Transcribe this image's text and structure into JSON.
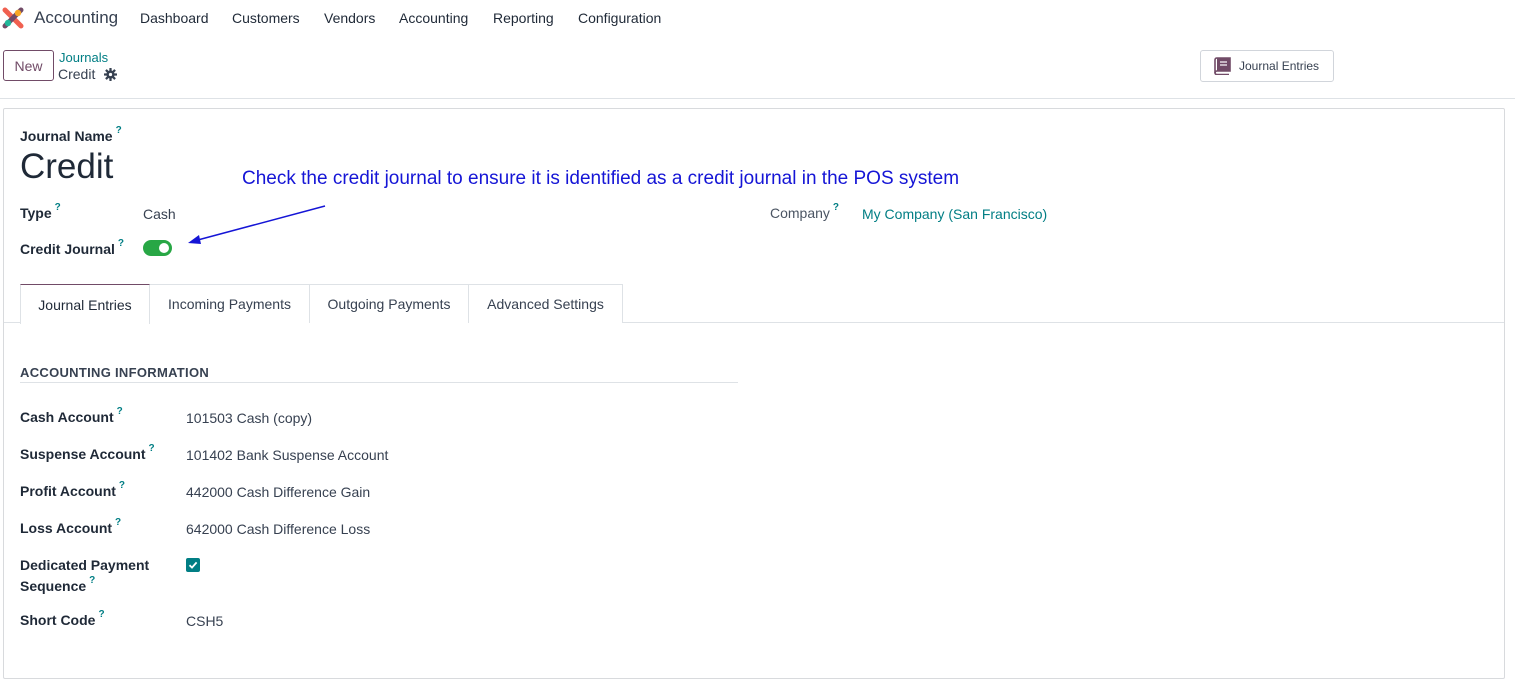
{
  "nav": {
    "app_name": "Accounting",
    "menus": [
      "Dashboard",
      "Customers",
      "Vendors",
      "Accounting",
      "Reporting",
      "Configuration"
    ]
  },
  "control_panel": {
    "new_label": "New",
    "breadcrumb_parent": "Journals",
    "breadcrumb_current": "Credit",
    "journal_entries_button": "Journal Entries"
  },
  "form": {
    "journal_name_label": "Journal Name",
    "journal_name": "Credit",
    "type_label": "Type",
    "type_value": "Cash",
    "credit_journal_label": "Credit Journal",
    "credit_journal_enabled": true,
    "company_label": "Company",
    "company_value": "My Company (San Francisco)",
    "help_mark": "?"
  },
  "annotation": "Check the credit journal to ensure it is identified as a credit journal in the POS system",
  "tabs": [
    "Journal Entries",
    "Incoming Payments",
    "Outgoing Payments",
    "Advanced Settings"
  ],
  "accounting_info": {
    "section_title": "ACCOUNTING INFORMATION",
    "cash_account_label": "Cash Account",
    "cash_account": "101503 Cash (copy)",
    "suspense_account_label": "Suspense Account",
    "suspense_account": "101402 Bank Suspense Account",
    "profit_account_label": "Profit Account",
    "profit_account": "442000 Cash Difference Gain",
    "loss_account_label": "Loss Account",
    "loss_account": "642000 Cash Difference Loss",
    "dedicated_seq_label_1": "Dedicated Payment",
    "dedicated_seq_label_2": "Sequence",
    "dedicated_seq_checked": true,
    "short_code_label": "Short Code",
    "short_code": "CSH5"
  },
  "colors": {
    "brand": "#714B67",
    "link": "#017e84",
    "toggle_on": "#28a745",
    "annotation": "#1515d6"
  }
}
